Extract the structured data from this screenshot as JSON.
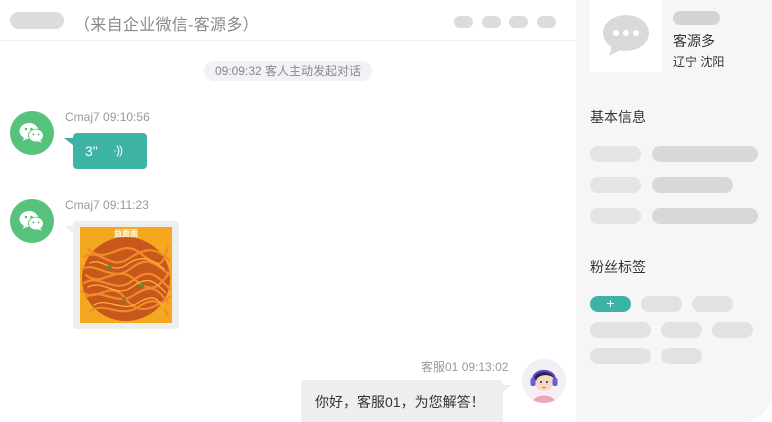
{
  "header": {
    "title": "（来自企业微信-客源多）"
  },
  "messages": {
    "system_notice": {
      "time": "09:09:32",
      "text": "客人主动发起对话"
    },
    "voice": {
      "sender": "Cmaj7",
      "time": "09:10:56",
      "duration": "3\"",
      "wave": "·))"
    },
    "image": {
      "sender": "Cmaj7",
      "time": "09:11:23",
      "caption": "益面面"
    },
    "agent_reply": {
      "sender": "客服01",
      "time": "09:13:02",
      "text": "你好，客服01，为您解答！"
    }
  },
  "customer_card": {
    "source": "客源多",
    "region": "辽宁 沈阳"
  },
  "sections": {
    "basic_info": "基本信息",
    "fan_tags": "粉丝标签"
  },
  "tags": {
    "add_label": "+"
  },
  "colors": {
    "accent": "#3db3a6",
    "wechat_green": "#56c27b"
  },
  "icons": {
    "wechat": "wechat-icon",
    "chat_bubble": "chat-bubble-icon",
    "voice_wave": "voice-wave-icon"
  }
}
